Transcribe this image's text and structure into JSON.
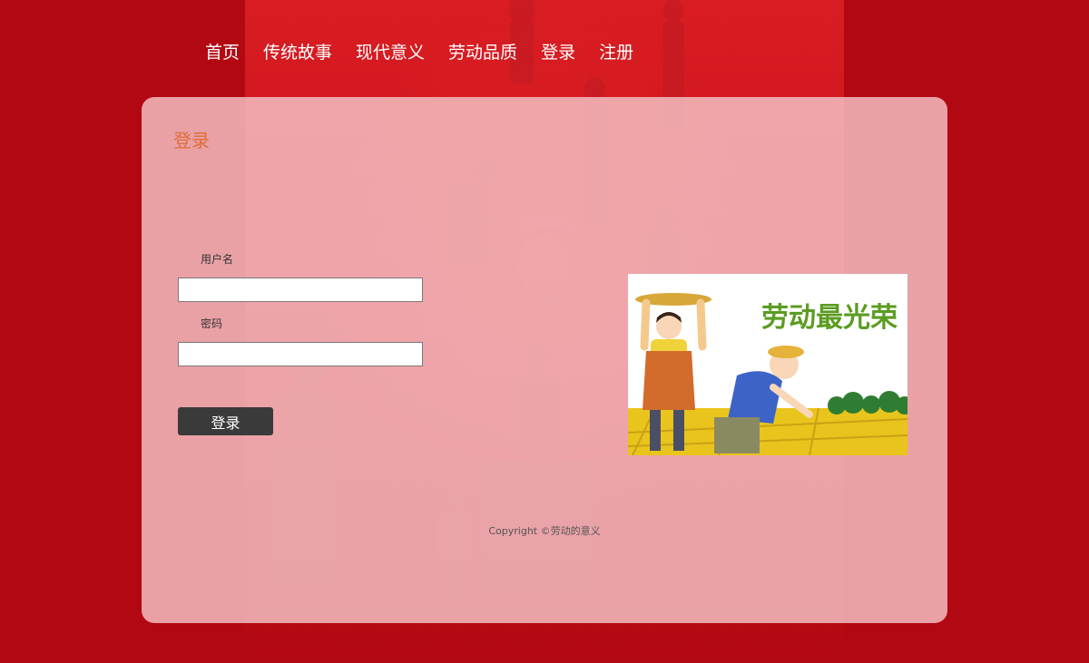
{
  "nav": {
    "items": [
      "首页",
      "传统故事",
      "现代意义",
      "劳动品质",
      "登录",
      "注册"
    ]
  },
  "login": {
    "title": "登录",
    "username_label": "用户名",
    "username_value": "",
    "password_label": "密码",
    "password_value": "",
    "submit_label": "登录"
  },
  "illustration": {
    "caption": "劳动最光荣"
  },
  "footer": {
    "copyright": "Copyright ©劳动的意义"
  },
  "colors": {
    "page_background": "#b20812",
    "title_accent": "#e06d35",
    "button_background": "#3a3a3a"
  }
}
